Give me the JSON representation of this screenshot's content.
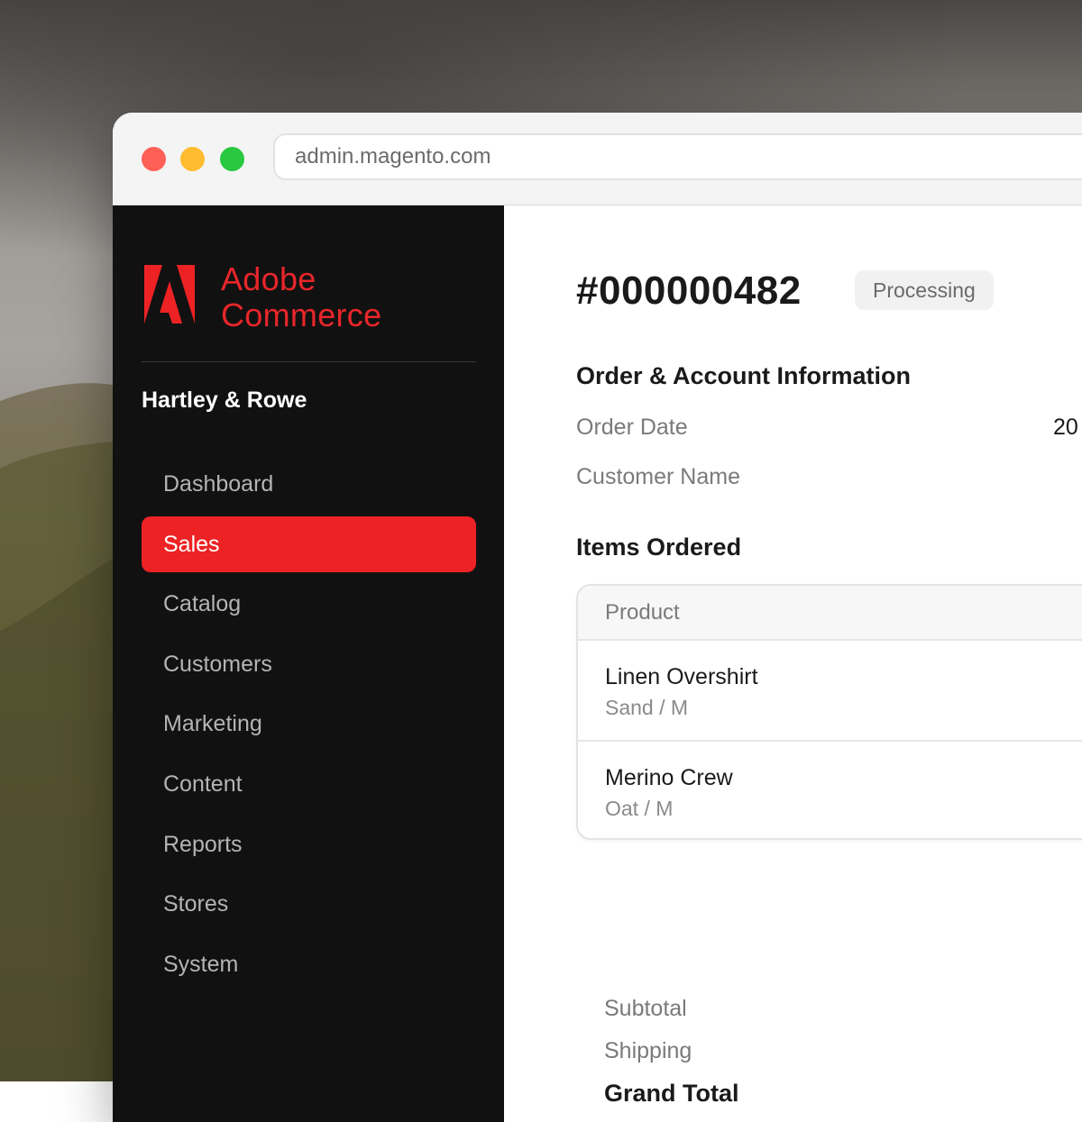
{
  "browser": {
    "url": "admin.magento.com"
  },
  "brand": {
    "name_line1": "Adobe",
    "name_line2": "Commerce",
    "accent_color": "#ed2224"
  },
  "sidebar": {
    "store_name": "Hartley & Rowe",
    "items": [
      {
        "label": "Dashboard",
        "active": false
      },
      {
        "label": "Sales",
        "active": true
      },
      {
        "label": "Catalog",
        "active": false
      },
      {
        "label": "Customers",
        "active": false
      },
      {
        "label": "Marketing",
        "active": false
      },
      {
        "label": "Content",
        "active": false
      },
      {
        "label": "Reports",
        "active": false
      },
      {
        "label": "Stores",
        "active": false
      },
      {
        "label": "System",
        "active": false
      }
    ]
  },
  "order": {
    "number": "#000000482",
    "status": "Processing",
    "info_title": "Order & Account Information",
    "order_date_label": "Order Date",
    "order_date_value": "20",
    "customer_name_label": "Customer Name",
    "items_title": "Items Ordered",
    "table_header": "Product",
    "items": [
      {
        "name": "Linen Overshirt",
        "variant": "Sand / M"
      },
      {
        "name": "Merino Crew",
        "variant": "Oat / M"
      }
    ],
    "totals": {
      "subtotal_label": "Subtotal",
      "shipping_label": "Shipping",
      "grand_total_label": "Grand Total"
    }
  }
}
